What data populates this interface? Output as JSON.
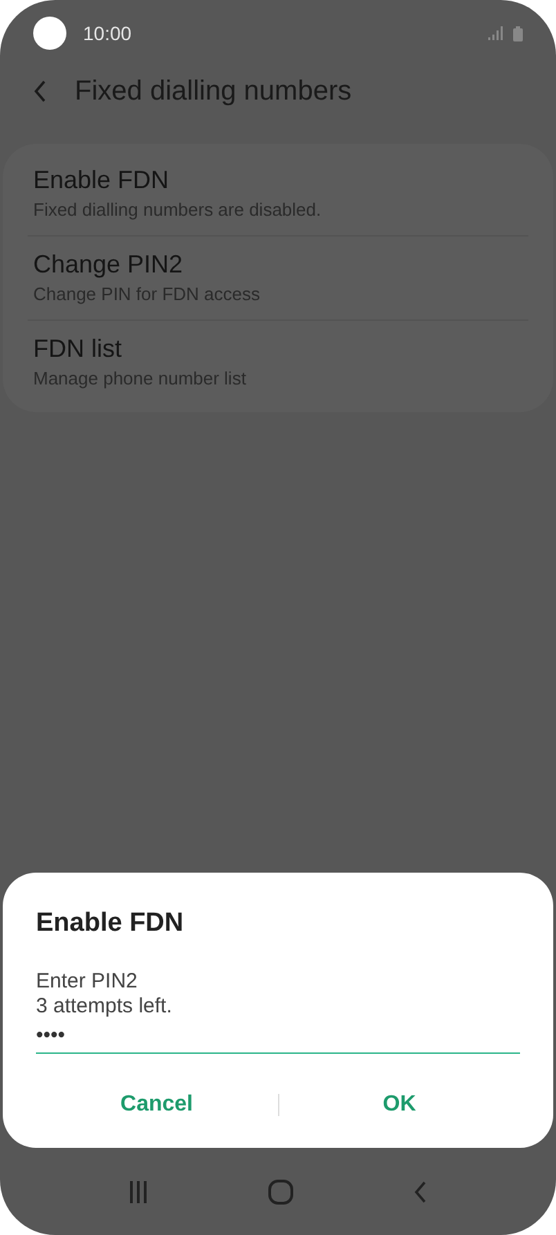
{
  "status_bar": {
    "time": "10:00"
  },
  "header": {
    "title": "Fixed dialling numbers"
  },
  "settings": [
    {
      "title": "Enable FDN",
      "subtitle": "Fixed dialling numbers are disabled."
    },
    {
      "title": "Change PIN2",
      "subtitle": "Change PIN for FDN access"
    },
    {
      "title": "FDN list",
      "subtitle": "Manage phone number list"
    }
  ],
  "dialog": {
    "title": "Enable FDN",
    "message": [
      "Enter PIN2",
      "3 attempts left."
    ],
    "pin_value": "••••",
    "buttons": [
      "Cancel",
      "OK"
    ]
  }
}
